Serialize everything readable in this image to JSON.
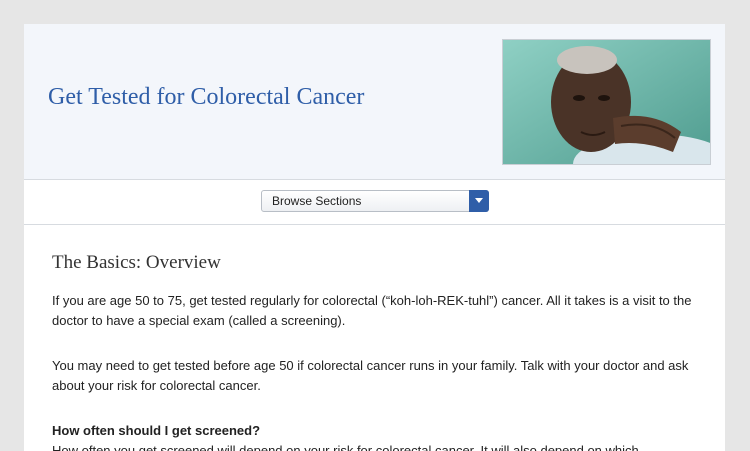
{
  "header": {
    "title": "Get Tested for Colorectal Cancer"
  },
  "nav": {
    "select_label": "Browse Sections",
    "arrow_icon": "chevron-down-icon",
    "accent_color": "#2f5ea8"
  },
  "content": {
    "section_title": "The Basics: Overview",
    "paragraphs": [
      "If you are age 50 to 75, get tested regularly for colorectal (“koh-loh-REK-tuhl”) cancer. All it takes is a visit to the doctor to have a special exam (called a screening).",
      "You may need to get tested before age 50 if colorectal cancer runs in your family. Talk with your doctor and ask about your risk for colorectal cancer."
    ],
    "subheading": "How often should I get screened?",
    "cut_paragraph": "How often you get screened will depend on your risk for colorectal cancer. It will also depend on which"
  }
}
